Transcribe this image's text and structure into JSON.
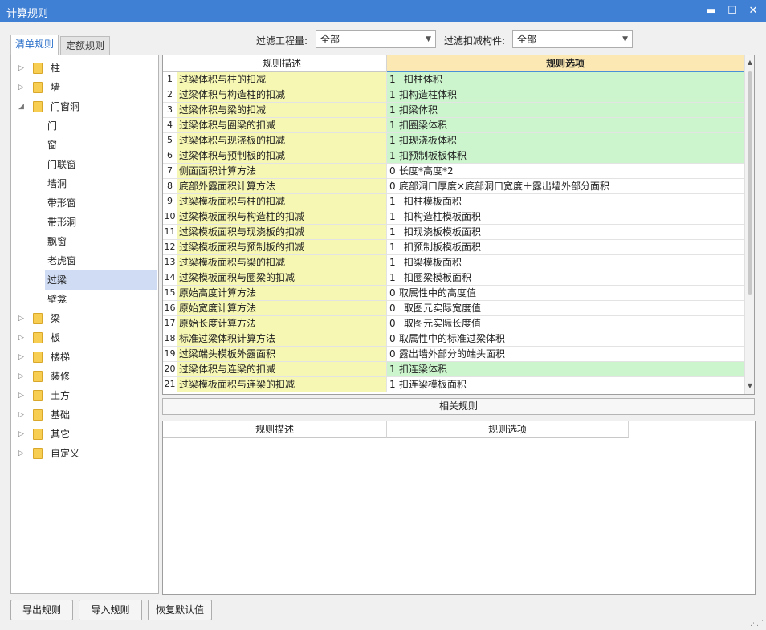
{
  "window": {
    "title": "计算规则",
    "minimize": "▬",
    "maximize": "☐",
    "close": "✕"
  },
  "tabs": [
    {
      "label": "清单规则",
      "active": true
    },
    {
      "label": "定额规则",
      "active": false
    }
  ],
  "filters": {
    "project_label": "过滤工程量:",
    "project_value": "全部",
    "deduct_label": "过滤扣减构件:",
    "deduct_value": "全部"
  },
  "tree": [
    {
      "label": "柱",
      "expandable": true,
      "expanded": false,
      "level": 0
    },
    {
      "label": "墙",
      "expandable": true,
      "expanded": false,
      "level": 0
    },
    {
      "label": "门窗洞",
      "expandable": true,
      "expanded": true,
      "level": 0
    },
    {
      "label": "门",
      "level": 1
    },
    {
      "label": "窗",
      "level": 1
    },
    {
      "label": "门联窗",
      "level": 1
    },
    {
      "label": "墙洞",
      "level": 1
    },
    {
      "label": "带形窗",
      "level": 1
    },
    {
      "label": "带形洞",
      "level": 1
    },
    {
      "label": "飘窗",
      "level": 1
    },
    {
      "label": "老虎窗",
      "level": 1
    },
    {
      "label": "过梁",
      "level": 1,
      "selected": true
    },
    {
      "label": "壁龛",
      "level": 1
    },
    {
      "label": "梁",
      "expandable": true,
      "expanded": false,
      "level": 0
    },
    {
      "label": "板",
      "expandable": true,
      "expanded": false,
      "level": 0
    },
    {
      "label": "楼梯",
      "expandable": true,
      "expanded": false,
      "level": 0
    },
    {
      "label": "装修",
      "expandable": true,
      "expanded": false,
      "level": 0
    },
    {
      "label": "土方",
      "expandable": true,
      "expanded": false,
      "level": 0
    },
    {
      "label": "基础",
      "expandable": true,
      "expanded": false,
      "level": 0
    },
    {
      "label": "其它",
      "expandable": true,
      "expanded": false,
      "level": 0
    },
    {
      "label": "自定义",
      "expandable": true,
      "expanded": false,
      "level": 0
    }
  ],
  "grid": {
    "headers": {
      "desc": "规则描述",
      "option": "规则选项"
    },
    "rows": [
      {
        "num": "1",
        "desc": "过梁体积与柱的扣减",
        "code": "1",
        "option": "扣柱体积",
        "gap": true,
        "green": true
      },
      {
        "num": "2",
        "desc": "过梁体积与构造柱的扣减",
        "code": "1",
        "option": "扣构造柱体积",
        "gap": false,
        "green": true
      },
      {
        "num": "3",
        "desc": "过梁体积与梁的扣减",
        "code": "1",
        "option": "扣梁体积",
        "gap": false,
        "green": true
      },
      {
        "num": "4",
        "desc": "过梁体积与圈梁的扣减",
        "code": "1",
        "option": "扣圈梁体积",
        "gap": false,
        "green": true
      },
      {
        "num": "5",
        "desc": "过梁体积与现浇板的扣减",
        "code": "1",
        "option": "扣现浇板体积",
        "gap": false,
        "green": true
      },
      {
        "num": "6",
        "desc": "过梁体积与预制板的扣减",
        "code": "1",
        "option": "扣预制板板体积",
        "gap": false,
        "green": true
      },
      {
        "num": "7",
        "desc": "侧面面积计算方法",
        "code": "0",
        "option": "长度*高度*2",
        "gap": false,
        "green": false
      },
      {
        "num": "8",
        "desc": "底部外露面积计算方法",
        "code": "0",
        "option": "底部洞口厚度×底部洞口宽度＋露出墙外部分面积",
        "gap": false,
        "green": false
      },
      {
        "num": "9",
        "desc": "过梁模板面积与柱的扣减",
        "code": "1",
        "option": "扣柱模板面积",
        "gap": true,
        "green": false
      },
      {
        "num": "10",
        "desc": "过梁模板面积与构造柱的扣减",
        "code": "1",
        "option": "扣构造柱模板面积",
        "gap": true,
        "green": false
      },
      {
        "num": "11",
        "desc": "过梁模板面积与现浇板的扣减",
        "code": "1",
        "option": "扣现浇板模板面积",
        "gap": true,
        "green": false
      },
      {
        "num": "12",
        "desc": "过梁模板面积与预制板的扣减",
        "code": "1",
        "option": "扣预制板模板面积",
        "gap": true,
        "green": false
      },
      {
        "num": "13",
        "desc": "过梁模板面积与梁的扣减",
        "code": "1",
        "option": "扣梁模板面积",
        "gap": true,
        "green": false
      },
      {
        "num": "14",
        "desc": "过梁模板面积与圈梁的扣减",
        "code": "1",
        "option": "扣圈梁模板面积",
        "gap": true,
        "green": false
      },
      {
        "num": "15",
        "desc": "原始高度计算方法",
        "code": "0",
        "option": "取属性中的高度值",
        "gap": false,
        "green": false
      },
      {
        "num": "16",
        "desc": "原始宽度计算方法",
        "code": "0",
        "option": "取图元实际宽度值",
        "gap": true,
        "green": false
      },
      {
        "num": "17",
        "desc": "原始长度计算方法",
        "code": "0",
        "option": "取图元实际长度值",
        "gap": true,
        "green": false
      },
      {
        "num": "18",
        "desc": "标准过梁体积计算方法",
        "code": "0",
        "option": "取属性中的标准过梁体积",
        "gap": false,
        "green": false
      },
      {
        "num": "19",
        "desc": "过梁端头模板外露面积",
        "code": "0",
        "option": "露出墙外部分的端头面积",
        "gap": false,
        "green": false
      },
      {
        "num": "20",
        "desc": "过梁体积与连梁的扣减",
        "code": "1",
        "option": "扣连梁体积",
        "gap": false,
        "green": true
      },
      {
        "num": "21",
        "desc": "过梁模板面积与连梁的扣减",
        "code": "1",
        "option": "扣连梁模板面积",
        "gap": false,
        "green": false
      }
    ]
  },
  "related": {
    "title": "相关规则",
    "headers": {
      "desc": "规则描述",
      "option": "规则选项"
    }
  },
  "buttons": {
    "export": "导出规则",
    "import": "导入规则",
    "restore": "恢复默认值"
  },
  "scroll_arrows": {
    "up": "▲",
    "down": "▼"
  },
  "colors": {
    "titlebar": "#3f7fd4",
    "desc_bg": "#f7f7b4",
    "option_green": "#ccf5cd",
    "option_header": "#fbe8b3",
    "selected": "#cfdcf3"
  }
}
